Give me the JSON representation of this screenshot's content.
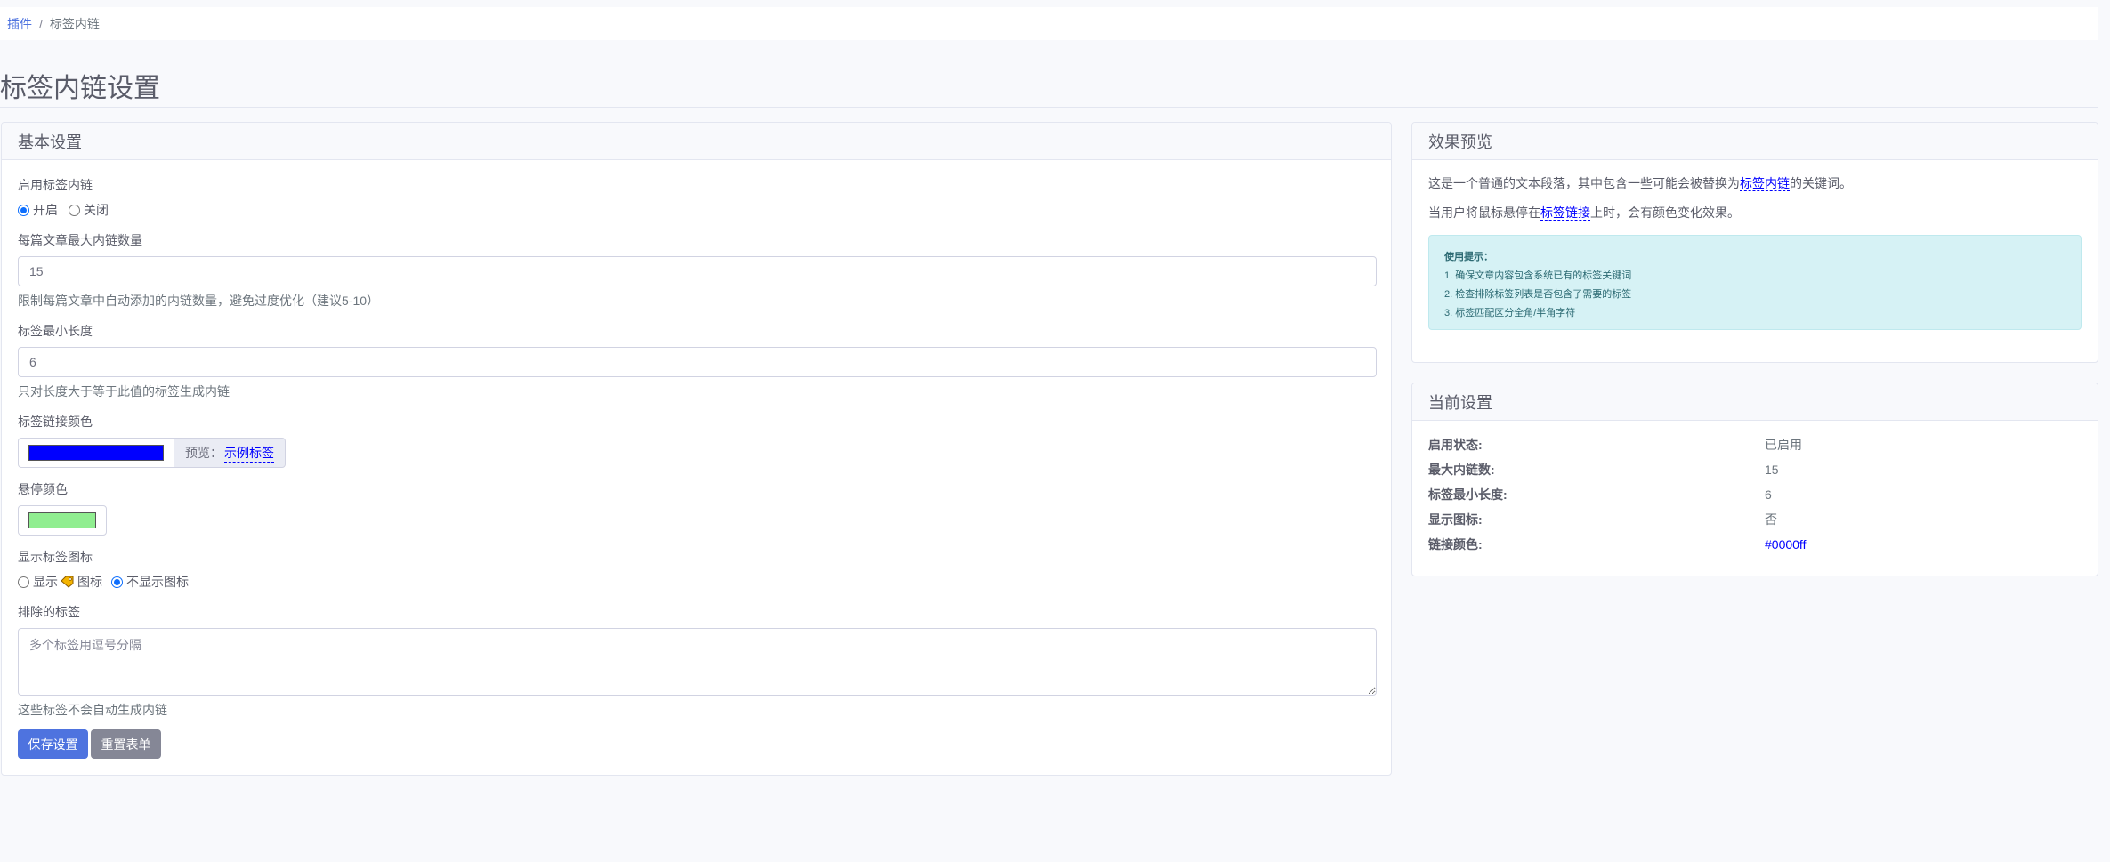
{
  "breadcrumb": {
    "parent": "插件",
    "separator": "/",
    "current": "标签内链"
  },
  "page_title": "标签内链设置",
  "basic": {
    "header": "基本设置",
    "enable_label": "启用标签内链",
    "enable_on": "开启",
    "enable_off": "关闭",
    "max_links_label": "每篇文章最大内链数量",
    "max_links_value": "15",
    "max_links_help": "限制每篇文章中自动添加的内链数量，避免过度优化（建议5-10）",
    "min_len_label": "标签最小长度",
    "min_len_value": "6",
    "min_len_help": "只对长度大于等于此值的标签生成内链",
    "link_color_label": "标签链接颜色",
    "link_color": "#0000ff",
    "preview_prefix": "预览：",
    "preview_link": "示例标签",
    "hover_color_label": "悬停颜色",
    "hover_color": "#90ee90",
    "show_icon_label": "显示标签图标",
    "show_icon_on": "显示",
    "show_icon_suffix": "图标",
    "show_icon_off": "不显示图标",
    "exclude_label": "排除的标签",
    "exclude_placeholder": "多个标签用逗号分隔",
    "exclude_help": "这些标签不会自动生成内链",
    "save_button": "保存设置",
    "reset_button": "重置表单"
  },
  "preview": {
    "header": "效果预览",
    "p1_before": "这是一个普通的文本段落，其中包含一些可能会被替换为",
    "p1_keyword": "标签内链",
    "p1_after": "的关键词。",
    "p2_before": "当用户将鼠标悬停在",
    "p2_keyword": "标签链接",
    "p2_after": "上时，会有颜色变化效果。",
    "tips_title": "使用提示：",
    "tips": [
      "1. 确保文章内容包含系统已有的标签关键词",
      "2. 检查排除标签列表是否包含了需要的标签",
      "3. 标签匹配区分全角/半角字符"
    ]
  },
  "current": {
    "header": "当前设置",
    "rows": [
      {
        "key": "启用状态:",
        "value": "已启用"
      },
      {
        "key": "最大内链数:",
        "value": "15"
      },
      {
        "key": "标签最小长度:",
        "value": "6"
      },
      {
        "key": "显示图标:",
        "value": "否"
      },
      {
        "key": "链接颜色:",
        "value": "#0000ff"
      }
    ]
  },
  "colors": {
    "primary": "#4e73df",
    "secondary": "#858796",
    "link": "#0000ff",
    "info_bg": "#d6f2f5"
  }
}
